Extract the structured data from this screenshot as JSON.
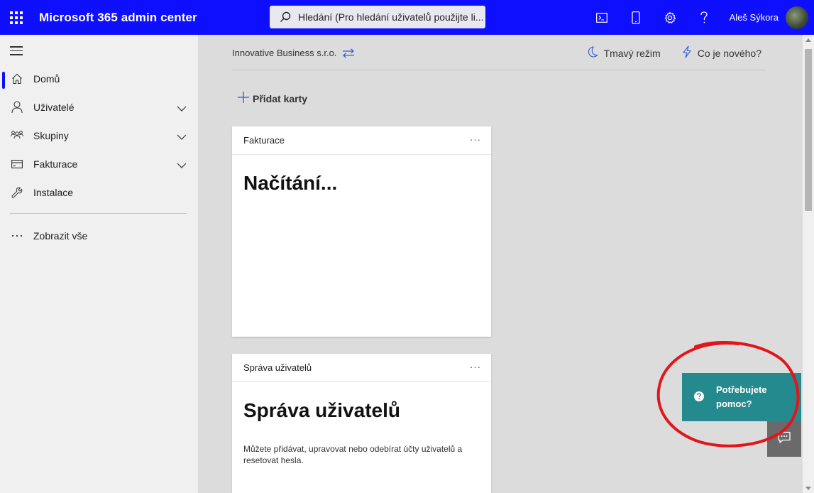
{
  "topbar": {
    "title": "Microsoft 365 admin center",
    "search_placeholder": "Hledání (Pro hledání uživatelů použijte li...",
    "user_name": "Aleš Sýkora",
    "icons": [
      "waffle-icon",
      "terminal-icon",
      "mobile-icon",
      "gear-icon",
      "help-icon"
    ],
    "bg_color": "#0f0fff"
  },
  "sidebar": {
    "items": [
      {
        "label": "Domů",
        "icon": "home-icon",
        "active": true
      },
      {
        "label": "Uživatelé",
        "icon": "person-icon",
        "expandable": true
      },
      {
        "label": "Skupiny",
        "icon": "group-icon",
        "expandable": true
      },
      {
        "label": "Fakturace",
        "icon": "card-icon",
        "expandable": true
      },
      {
        "label": "Instalace",
        "icon": "wrench-icon"
      },
      {
        "label": "Zobrazit vše",
        "icon": "more-icon"
      }
    ]
  },
  "main": {
    "org_name": "Innovative Business s.r.o.",
    "dark_mode": "Tmavý režim",
    "whats_new": "Co je nového?",
    "add_cards": "Přidat karty",
    "cards": [
      {
        "title": "Fakturace",
        "more": "···",
        "heading": "Načítání..."
      },
      {
        "title": "Správa uživatelů",
        "more": "···",
        "heading": "Správa uživatelů",
        "description": "Můžete přidávat, upravovat nebo odebírat účty uživatelů a resetovat hesla."
      }
    ]
  },
  "help": {
    "label": "Potřebujete pomoc?",
    "bg_color": "#248a8e"
  },
  "annotation_color": "#e0161b"
}
